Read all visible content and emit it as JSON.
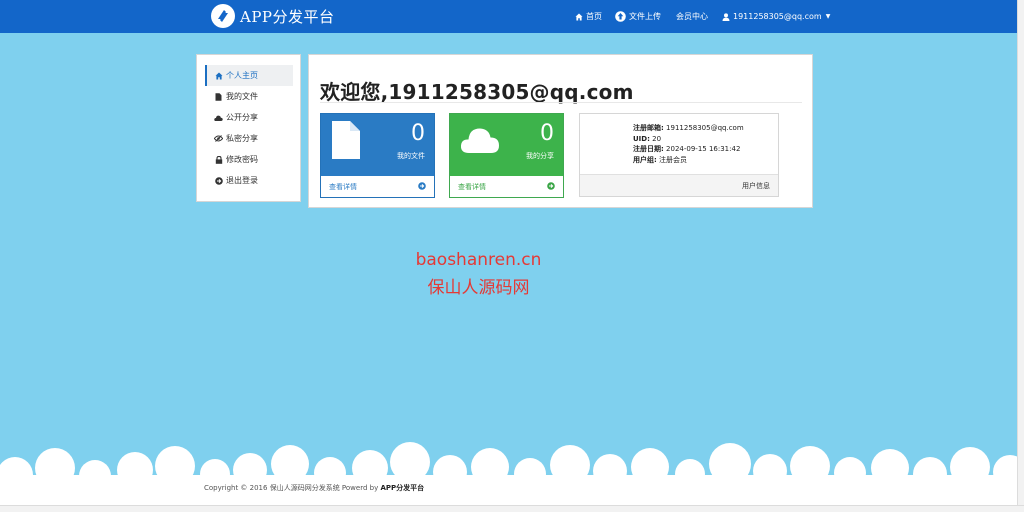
{
  "brand": {
    "name": "APP分发平台",
    "icon": "logo-icon"
  },
  "nav": {
    "home": "首页",
    "upload": "文件上传",
    "member": "会员中心",
    "user": "1911258305@qq.com"
  },
  "sidebar": {
    "items": [
      {
        "label": "个人主页",
        "icon": "home-icon",
        "active": true
      },
      {
        "label": "我的文件",
        "icon": "file-icon"
      },
      {
        "label": "公开分享",
        "icon": "cloud-icon"
      },
      {
        "label": "私密分享",
        "icon": "eye-slash-icon"
      },
      {
        "label": "修改密码",
        "icon": "lock-icon"
      },
      {
        "label": "退出登录",
        "icon": "signout-icon"
      }
    ]
  },
  "main": {
    "welcome": "欢迎您,1911258305@qq.com",
    "cards": [
      {
        "value": "0",
        "label": "我的文件",
        "link": "查看详情",
        "color": "#2a7bc4",
        "icon": "file-icon"
      },
      {
        "value": "0",
        "label": "我的分享",
        "link": "查看详情",
        "color": "#3db34b",
        "icon": "cloud-icon"
      }
    ],
    "info": {
      "email_label": "注册邮箱:",
      "email": "1911258305@qq.com",
      "uid_label": "UID:",
      "uid": "20",
      "date_label": "注册日期:",
      "date": "2024-09-15 16:31:42",
      "group_label": "用户组:",
      "group": "注册会员",
      "footer": "用户信息"
    }
  },
  "watermark": {
    "line1": "baoshanren.cn",
    "line2": "保山人源码网"
  },
  "footer": {
    "text": "Copyright © 2016 保山人源码网分发系统 Powerd by",
    "brand": "APP分发平台"
  }
}
